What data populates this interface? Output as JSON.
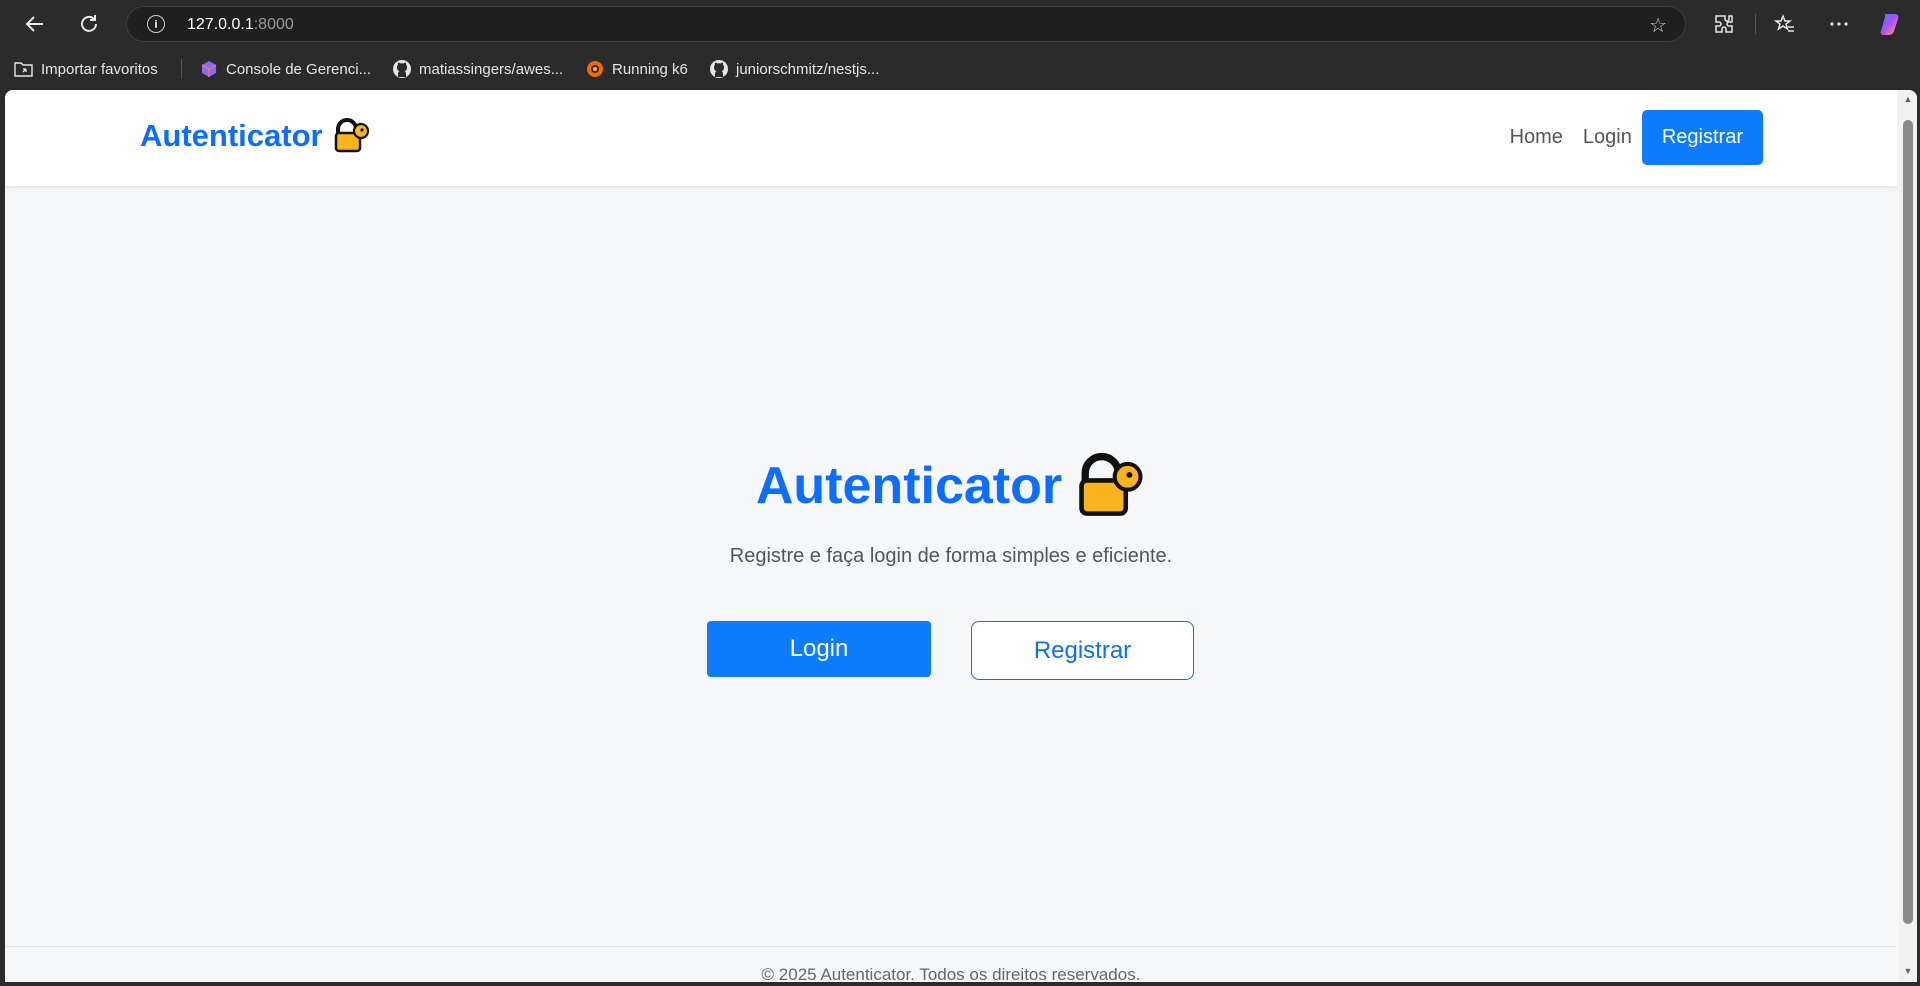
{
  "browser": {
    "url_host": "127.0.0.1",
    "url_port": ":8000",
    "bookmarks": [
      {
        "label": "Importar favoritos",
        "icon": "folder-import-icon"
      },
      {
        "label": "Console de Gerenci...",
        "icon": "cube-icon"
      },
      {
        "label": "matiassingers/awes...",
        "icon": "github-icon"
      },
      {
        "label": "Running k6",
        "icon": "grafana-icon"
      },
      {
        "label": "juniorschmitz/nestjs...",
        "icon": "github-icon"
      }
    ]
  },
  "site": {
    "brand": "Autenticator",
    "nav": {
      "home": "Home",
      "login": "Login",
      "register": "Registrar"
    },
    "hero": {
      "title": "Autenticator",
      "subtitle": "Registre e faça login de forma simples e eficiente.",
      "login_label": "Login",
      "register_label": "Registrar"
    },
    "footer": "© 2025 Autenticator. Todos os direitos reservados."
  },
  "colors": {
    "accent": "#0d6efd",
    "button": "#0d7dfd",
    "background": "#f6f7f9"
  }
}
